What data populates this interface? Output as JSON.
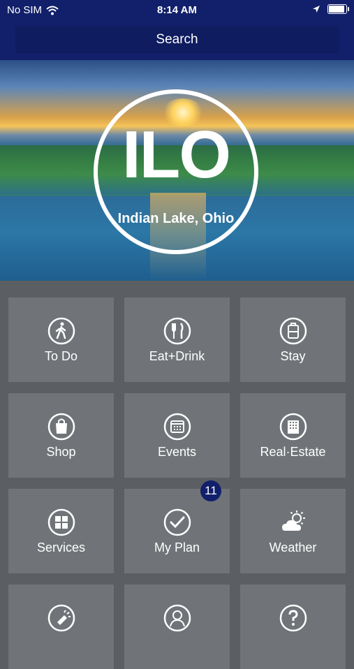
{
  "status": {
    "carrier": "No SIM",
    "time": "8:14 AM"
  },
  "search": {
    "label": "Search"
  },
  "hero": {
    "logo_big": "ILO",
    "logo_small": "Indian Lake, Ohio"
  },
  "tiles": [
    {
      "label": "To Do",
      "icon": "walking-person-icon"
    },
    {
      "label": "Eat+Drink",
      "icon": "fork-knife-icon"
    },
    {
      "label": "Stay",
      "icon": "luggage-icon"
    },
    {
      "label": "Shop",
      "icon": "shopping-bag-icon"
    },
    {
      "label": "Events",
      "icon": "calendar-icon"
    },
    {
      "label": "Real·Estate",
      "icon": "building-icon"
    },
    {
      "label": "Services",
      "icon": "services-icon"
    },
    {
      "label": "My Plan",
      "icon": "checkmark-icon",
      "badge": "11"
    },
    {
      "label": "Weather",
      "icon": "weather-icon"
    },
    {
      "label": "",
      "icon": "flashlight-icon"
    },
    {
      "label": "",
      "icon": "person-icon"
    },
    {
      "label": "",
      "icon": "question-icon"
    }
  ]
}
